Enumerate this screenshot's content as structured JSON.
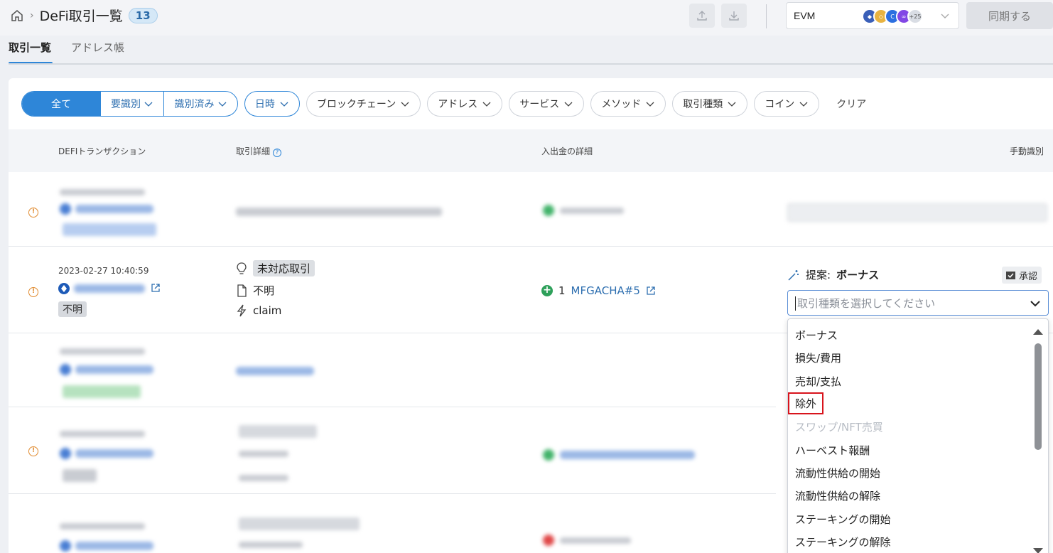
{
  "header": {
    "page_title": "DeFi取引一覧",
    "count": "13",
    "chain_selector": {
      "value": "EVM",
      "more_count": "+25"
    },
    "sync_label": "同期する"
  },
  "tabs": [
    {
      "label": "取引一覧",
      "active": true
    },
    {
      "label": "アドレス帳",
      "active": false
    }
  ],
  "filters": {
    "segmented": [
      "全て",
      "要識別",
      "識別済み"
    ],
    "pills": [
      "日時",
      "ブロックチェーン",
      "アドレス",
      "サービス",
      "メソッド",
      "取引種類",
      "コイン"
    ],
    "clear_label": "クリア"
  },
  "table": {
    "columns": [
      "DEFIトランザクション",
      "取引詳細",
      "入出金の詳細",
      "手動識別"
    ]
  },
  "focused_row": {
    "datetime": "2023-02-27 10:40:59",
    "tag": "不明",
    "detail_type": "未対応取引",
    "detail_service": "不明",
    "detail_method": "claim",
    "amount": "1",
    "nft": "MFGACHA#5",
    "suggestion_label": "提案:",
    "suggestion_value": "ボーナス",
    "approve_label": "承認",
    "type_placeholder": "取引種類を選択してください"
  },
  "dropdown": {
    "options": [
      {
        "label": "ボーナス"
      },
      {
        "label": "損失/費用"
      },
      {
        "label": "売却/支払"
      },
      {
        "label": "除外",
        "highlight": true
      },
      {
        "label": "スワップ/NFT売買",
        "disabled": true
      },
      {
        "label": "ハーベスト報酬"
      },
      {
        "label": "流動性供給の開始"
      },
      {
        "label": "流動性供給の解除"
      },
      {
        "label": "ステーキングの開始"
      },
      {
        "label": "ステーキングの解除"
      }
    ]
  },
  "colors": {
    "primary": "#2e86d8",
    "highlight_border": "#d8141c",
    "warning": "#e08a2e",
    "positive": "#2ea05a"
  }
}
